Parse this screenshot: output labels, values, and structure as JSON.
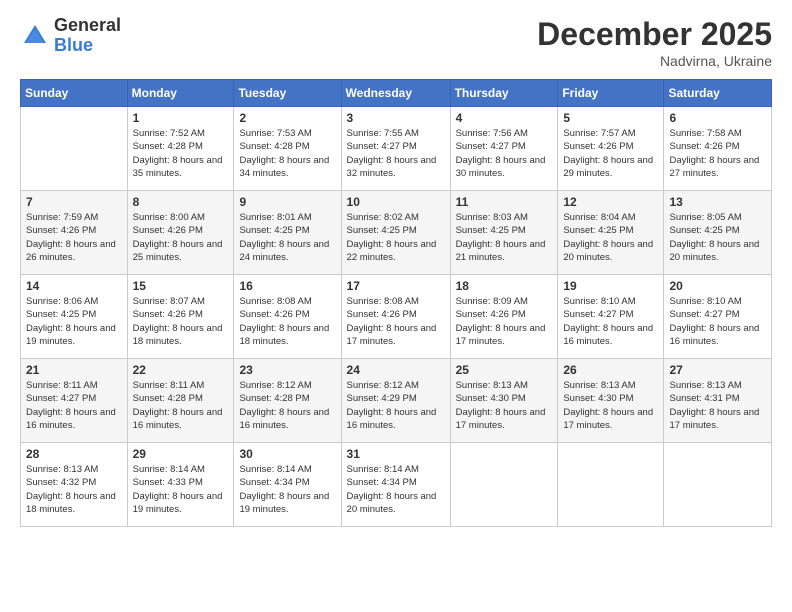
{
  "logo": {
    "general": "General",
    "blue": "Blue"
  },
  "header": {
    "month_year": "December 2025",
    "location": "Nadvirna, Ukraine"
  },
  "weekdays": [
    "Sunday",
    "Monday",
    "Tuesday",
    "Wednesday",
    "Thursday",
    "Friday",
    "Saturday"
  ],
  "weeks": [
    [
      {
        "day": "",
        "sunrise": "",
        "sunset": "",
        "daylight": ""
      },
      {
        "day": "1",
        "sunrise": "Sunrise: 7:52 AM",
        "sunset": "Sunset: 4:28 PM",
        "daylight": "Daylight: 8 hours and 35 minutes."
      },
      {
        "day": "2",
        "sunrise": "Sunrise: 7:53 AM",
        "sunset": "Sunset: 4:28 PM",
        "daylight": "Daylight: 8 hours and 34 minutes."
      },
      {
        "day": "3",
        "sunrise": "Sunrise: 7:55 AM",
        "sunset": "Sunset: 4:27 PM",
        "daylight": "Daylight: 8 hours and 32 minutes."
      },
      {
        "day": "4",
        "sunrise": "Sunrise: 7:56 AM",
        "sunset": "Sunset: 4:27 PM",
        "daylight": "Daylight: 8 hours and 30 minutes."
      },
      {
        "day": "5",
        "sunrise": "Sunrise: 7:57 AM",
        "sunset": "Sunset: 4:26 PM",
        "daylight": "Daylight: 8 hours and 29 minutes."
      },
      {
        "day": "6",
        "sunrise": "Sunrise: 7:58 AM",
        "sunset": "Sunset: 4:26 PM",
        "daylight": "Daylight: 8 hours and 27 minutes."
      }
    ],
    [
      {
        "day": "7",
        "sunrise": "Sunrise: 7:59 AM",
        "sunset": "Sunset: 4:26 PM",
        "daylight": "Daylight: 8 hours and 26 minutes."
      },
      {
        "day": "8",
        "sunrise": "Sunrise: 8:00 AM",
        "sunset": "Sunset: 4:26 PM",
        "daylight": "Daylight: 8 hours and 25 minutes."
      },
      {
        "day": "9",
        "sunrise": "Sunrise: 8:01 AM",
        "sunset": "Sunset: 4:25 PM",
        "daylight": "Daylight: 8 hours and 24 minutes."
      },
      {
        "day": "10",
        "sunrise": "Sunrise: 8:02 AM",
        "sunset": "Sunset: 4:25 PM",
        "daylight": "Daylight: 8 hours and 22 minutes."
      },
      {
        "day": "11",
        "sunrise": "Sunrise: 8:03 AM",
        "sunset": "Sunset: 4:25 PM",
        "daylight": "Daylight: 8 hours and 21 minutes."
      },
      {
        "day": "12",
        "sunrise": "Sunrise: 8:04 AM",
        "sunset": "Sunset: 4:25 PM",
        "daylight": "Daylight: 8 hours and 20 minutes."
      },
      {
        "day": "13",
        "sunrise": "Sunrise: 8:05 AM",
        "sunset": "Sunset: 4:25 PM",
        "daylight": "Daylight: 8 hours and 20 minutes."
      }
    ],
    [
      {
        "day": "14",
        "sunrise": "Sunrise: 8:06 AM",
        "sunset": "Sunset: 4:25 PM",
        "daylight": "Daylight: 8 hours and 19 minutes."
      },
      {
        "day": "15",
        "sunrise": "Sunrise: 8:07 AM",
        "sunset": "Sunset: 4:26 PM",
        "daylight": "Daylight: 8 hours and 18 minutes."
      },
      {
        "day": "16",
        "sunrise": "Sunrise: 8:08 AM",
        "sunset": "Sunset: 4:26 PM",
        "daylight": "Daylight: 8 hours and 18 minutes."
      },
      {
        "day": "17",
        "sunrise": "Sunrise: 8:08 AM",
        "sunset": "Sunset: 4:26 PM",
        "daylight": "Daylight: 8 hours and 17 minutes."
      },
      {
        "day": "18",
        "sunrise": "Sunrise: 8:09 AM",
        "sunset": "Sunset: 4:26 PM",
        "daylight": "Daylight: 8 hours and 17 minutes."
      },
      {
        "day": "19",
        "sunrise": "Sunrise: 8:10 AM",
        "sunset": "Sunset: 4:27 PM",
        "daylight": "Daylight: 8 hours and 16 minutes."
      },
      {
        "day": "20",
        "sunrise": "Sunrise: 8:10 AM",
        "sunset": "Sunset: 4:27 PM",
        "daylight": "Daylight: 8 hours and 16 minutes."
      }
    ],
    [
      {
        "day": "21",
        "sunrise": "Sunrise: 8:11 AM",
        "sunset": "Sunset: 4:27 PM",
        "daylight": "Daylight: 8 hours and 16 minutes."
      },
      {
        "day": "22",
        "sunrise": "Sunrise: 8:11 AM",
        "sunset": "Sunset: 4:28 PM",
        "daylight": "Daylight: 8 hours and 16 minutes."
      },
      {
        "day": "23",
        "sunrise": "Sunrise: 8:12 AM",
        "sunset": "Sunset: 4:28 PM",
        "daylight": "Daylight: 8 hours and 16 minutes."
      },
      {
        "day": "24",
        "sunrise": "Sunrise: 8:12 AM",
        "sunset": "Sunset: 4:29 PM",
        "daylight": "Daylight: 8 hours and 16 minutes."
      },
      {
        "day": "25",
        "sunrise": "Sunrise: 8:13 AM",
        "sunset": "Sunset: 4:30 PM",
        "daylight": "Daylight: 8 hours and 17 minutes."
      },
      {
        "day": "26",
        "sunrise": "Sunrise: 8:13 AM",
        "sunset": "Sunset: 4:30 PM",
        "daylight": "Daylight: 8 hours and 17 minutes."
      },
      {
        "day": "27",
        "sunrise": "Sunrise: 8:13 AM",
        "sunset": "Sunset: 4:31 PM",
        "daylight": "Daylight: 8 hours and 17 minutes."
      }
    ],
    [
      {
        "day": "28",
        "sunrise": "Sunrise: 8:13 AM",
        "sunset": "Sunset: 4:32 PM",
        "daylight": "Daylight: 8 hours and 18 minutes."
      },
      {
        "day": "29",
        "sunrise": "Sunrise: 8:14 AM",
        "sunset": "Sunset: 4:33 PM",
        "daylight": "Daylight: 8 hours and 19 minutes."
      },
      {
        "day": "30",
        "sunrise": "Sunrise: 8:14 AM",
        "sunset": "Sunset: 4:34 PM",
        "daylight": "Daylight: 8 hours and 19 minutes."
      },
      {
        "day": "31",
        "sunrise": "Sunrise: 8:14 AM",
        "sunset": "Sunset: 4:34 PM",
        "daylight": "Daylight: 8 hours and 20 minutes."
      },
      {
        "day": "",
        "sunrise": "",
        "sunset": "",
        "daylight": ""
      },
      {
        "day": "",
        "sunrise": "",
        "sunset": "",
        "daylight": ""
      },
      {
        "day": "",
        "sunrise": "",
        "sunset": "",
        "daylight": ""
      }
    ]
  ]
}
